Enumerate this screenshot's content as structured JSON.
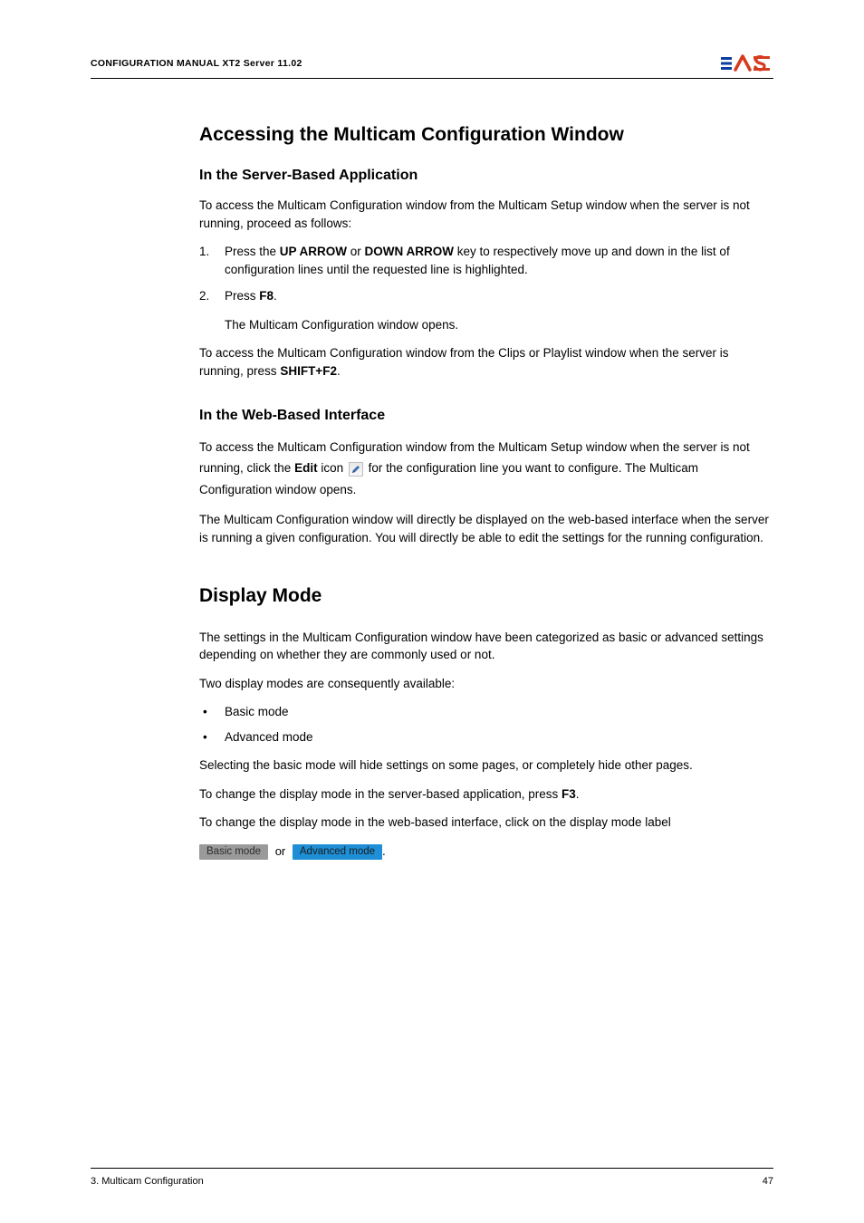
{
  "header": {
    "title": "CONFIGURATION MANUAL  XT2 Server 11.02",
    "logo_alt": "EVS"
  },
  "s1": {
    "h2": "Accessing the Multicam Configuration Window",
    "sb": {
      "h3": "In the Server-Based Application",
      "p1": "To access the Multicam Configuration window from the Multicam Setup window when the server is not running, proceed as follows:",
      "li1_a": "Press the ",
      "li1_b": "UP ARROW",
      "li1_c": " or ",
      "li1_d": "DOWN ARROW",
      "li1_e": " key to respectively move up and down in the list of configuration lines until the requested line is highlighted.",
      "li2_a": "Press ",
      "li2_b": "F8",
      "li2_c": ".",
      "sub": "The Multicam Configuration window opens.",
      "p2_a": "To access the Multicam Configuration window from the Clips or Playlist window when the server is running, press ",
      "p2_b": "SHIFT+F2",
      "p2_c": "."
    },
    "wb": {
      "h3": "In the Web-Based Interface",
      "p1_a": "To access the Multicam Configuration window from the Multicam Setup window when the server is not running, click the ",
      "p1_b": "Edit",
      "p1_c": " icon ",
      "p1_d": " for the configuration line you want to configure. The Multicam Configuration window opens.",
      "p2": "The Multicam Configuration window will directly be displayed on the web-based interface when the server is running a given configuration. You will directly be able to edit the settings for the running configuration."
    }
  },
  "s2": {
    "h2": "Display Mode",
    "p1": "The settings in the Multicam Configuration window have been categorized as basic or advanced settings depending on whether they are commonly used or not.",
    "p2": "Two display modes are consequently available:",
    "bi1": "Basic mode",
    "bi2": "Advanced mode",
    "p3": "Selecting the basic mode will hide settings on some pages, or completely hide other pages.",
    "p4_a": "To change the display mode in the server-based application, press ",
    "p4_b": "F3",
    "p4_c": ".",
    "p5": "To change the display mode in the web-based interface, click on the display mode label",
    "basic_label": "Basic mode",
    "or": " or ",
    "adv_label": "Advanced mode",
    "period": "."
  },
  "footer": {
    "left": "3. Multicam Configuration",
    "right": "47"
  }
}
